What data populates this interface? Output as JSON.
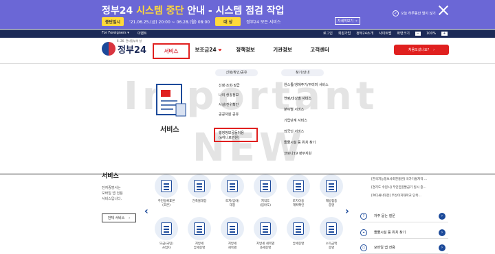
{
  "banner": {
    "title_prefix": "정부24 ",
    "title_highlight": "시스템 중단",
    "title_suffix": " 안내 - 시스템 점검 작업",
    "pill_stop": "중단일시",
    "period": "'21.06.25.(금) 20:00 ~ 06.28.(월) 08:00",
    "pill_target": "대 상",
    "target": "정부24 모든 서비스",
    "detail_link": "자세히보기 →",
    "today_close": "오늘 하루동안 열지 않기"
  },
  "utilbar": {
    "left": [
      "For Foreigners ▾",
      "이벤트"
    ],
    "right": [
      "로그인",
      "회원가입",
      "정부24소개",
      "사이트맵",
      "화면크기"
    ],
    "zoom": "100%"
  },
  "header": {
    "logo_sub": "6. 26. 전자정부의 날",
    "logo_text": "정부24",
    "nav": [
      {
        "label": "서비스",
        "active": true
      },
      {
        "label": "보조금24",
        "active": false,
        "badge": "❤"
      },
      {
        "label": "정책정보",
        "active": false
      },
      {
        "label": "기관정보",
        "active": false
      },
      {
        "label": "고객센터",
        "active": false
      }
    ],
    "guide_button": "처음오셨나요?",
    "guide_arrow": "›"
  },
  "mega": {
    "watermark1": "Important",
    "watermark2": "NEW",
    "section_title": "서비스",
    "col1_head": "신청/확인/공유",
    "col1_items": [
      "신청·조회·발급",
      "나의 생활정보",
      "사실/진위확인",
      "공공자원 공유"
    ],
    "col1_highlight_l1": "행정정보공동이용",
    "col1_highlight_l2": "(e하나로민원)",
    "col2_head": "찾기/안내",
    "col2_items": [
      "원스톱/생애주기/꾸러미 서비스",
      "연령/대상별 서비스",
      "분야별 서비스",
      "기업단계 서비스",
      "외국인 서비스",
      "들물시설 등 위치 찾기",
      "코로나19 정부지원"
    ]
  },
  "lower": {
    "title": "서비스",
    "desc": [
      "전자증명서는",
      "모바일 앱 전용",
      "서비스입니다."
    ],
    "button": "전체 서비스",
    "button_arrow": "›",
    "icons_row1": [
      {
        "label1": "주민등록표본",
        "label2": "(초본)"
      },
      {
        "label1": "건축물대장",
        "label2": ""
      },
      {
        "label1": "토지(임야)",
        "label2": "대장"
      },
      {
        "label1": "지적도",
        "label2": "(임야도)"
      },
      {
        "label1": "토지이용",
        "label2": "계획확인"
      },
      {
        "label1": "제방접종",
        "label2": "증명"
      }
    ],
    "icons_row2": [
      {
        "label1": "모금(국민)",
        "label2": "사업자"
      },
      {
        "label1": "지방세",
        "label2": "납세증명"
      },
      {
        "label1": "지방세",
        "label2": "세목별"
      },
      {
        "label1": "지방세 세목별",
        "label2": "과세증명"
      },
      {
        "label1": "납세증명",
        "label2": ""
      },
      {
        "label1": "소득금액",
        "label2": "증명"
      }
    ],
    "news": [
      "[한국지능정보사회진흥원] 국가기술자격 ...",
      "[경기도 수원시] 무인민원발급기 일시 중...",
      "[여디새나대전] 부산이지대학교 단축..."
    ],
    "quick": [
      {
        "icon": "?",
        "label": "자주 묻는 질문"
      },
      {
        "icon": "⌖",
        "label": "들물시설 등 위치 찾기"
      },
      {
        "icon": "▭",
        "label": "모바일 앱 전용"
      }
    ],
    "go": "›"
  }
}
